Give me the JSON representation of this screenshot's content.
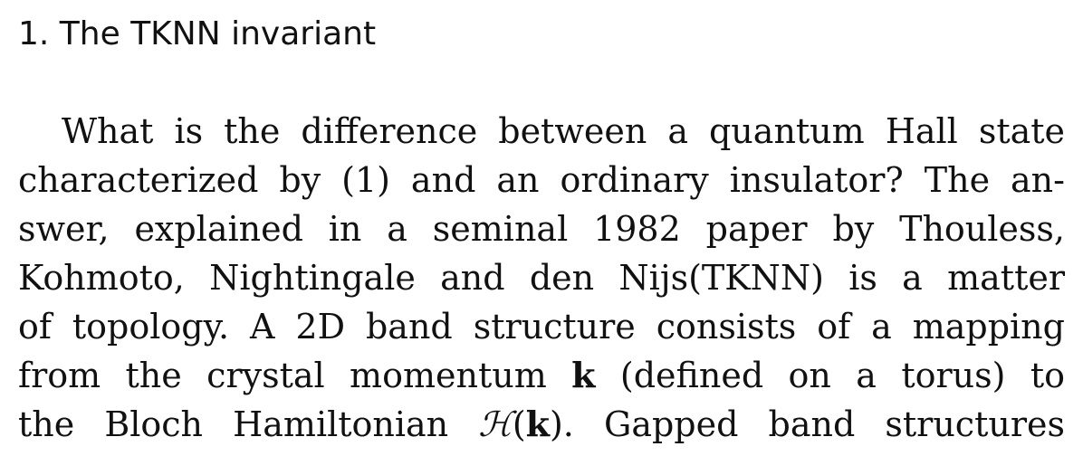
{
  "section": {
    "heading": "1. The TKNN invariant"
  },
  "paragraph": {
    "line1": "What is the difference between a quantum Hall state",
    "line2": "characterized by (1) and an ordinary insulator? The an-",
    "line3": "swer, explained in a seminal 1982 paper by Thouless,",
    "line4": "Kohmoto, Nightingale and den Nijs(TKNN) is a matter",
    "line5": "of topology. A 2D band structure consists of a mapping",
    "line6_pre": "from the crystal momentum ",
    "line6_k": "k",
    "line6_post": " (defined on a torus) to",
    "line7_pre": "the Bloch Hamiltonian ",
    "line7_h": "ℋ",
    "line7_open": "(",
    "line7_k": "k",
    "line7_close": ").",
    "line7_post": " Gapped band structures"
  }
}
